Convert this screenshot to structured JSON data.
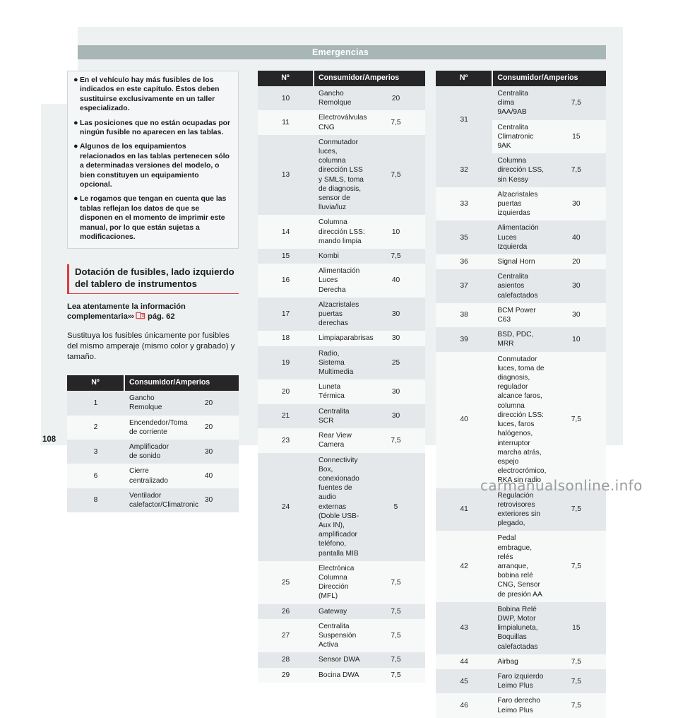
{
  "header": {
    "title": "Emergencias"
  },
  "folio": "108",
  "watermark": "carmanualsonline.info",
  "note_box": {
    "items": [
      "En el vehículo hay más fusibles de los indicados en este capítulo. Éstos deben sustituirse exclusivamente en un taller especializado.",
      "Las posiciones que no están ocupadas por ningún fusible no aparecen en las tablas.",
      "Algunos de los equipamientos relacionados en las tablas pertenecen sólo a determinadas versiones del modelo, o bien constituyen un equipamiento opcional.",
      "Le rogamos que tengan en cuenta que las tablas reflejan los datos de que se disponen en el momento de imprimir este manual, por lo que están sujetas a modificaciones."
    ],
    "bullet": "●"
  },
  "section": {
    "heading": "Dotación de fusibles, lado izquierdo del tablero de instrumentos",
    "lead_prefix": "Lea atentamente la información complementaria",
    "lead_chevrons": "›››",
    "lead_ref": "pág. 62",
    "ref_icon": "book-reference-icon",
    "body": "Sustituya los fusibles únicamente por fusibles del mismo amperaje (mismo color y grabado) y tamaño."
  },
  "tables": {
    "columns": {
      "num": "Nº",
      "consumer": "Consumidor/Amperios"
    },
    "left": [
      {
        "num": "1",
        "consumer": "Gancho Remolque",
        "amps": "20"
      },
      {
        "num": "2",
        "consumer": "Encendedor/Toma de corriente",
        "amps": "20"
      },
      {
        "num": "3",
        "consumer": "Amplificador de sonido",
        "amps": "30"
      },
      {
        "num": "6",
        "consumer": "Cierre centralizado",
        "amps": "40"
      },
      {
        "num": "8",
        "consumer": "Ventilador calefactor/Climatronic",
        "amps": "30"
      }
    ],
    "middle": [
      {
        "num": "10",
        "consumer": "Gancho Remolque",
        "amps": "20"
      },
      {
        "num": "11",
        "consumer": "Electroválvulas CNG",
        "amps": "7,5"
      },
      {
        "num": "13",
        "consumer": "Conmutador luces, columna dirección LSS y SMLS, toma de diagnosis, sensor de lluvia/luz",
        "amps": "7,5"
      },
      {
        "num": "14",
        "consumer": "Columna dirección LSS: mando limpia",
        "amps": "10"
      },
      {
        "num": "15",
        "consumer": "Kombi",
        "amps": "7,5"
      },
      {
        "num": "16",
        "consumer": "Alimentación Luces Derecha",
        "amps": "40"
      },
      {
        "num": "17",
        "consumer": "Alzacristales puertas derechas",
        "amps": "30"
      },
      {
        "num": "18",
        "consumer": "Limpiaparabrisas",
        "amps": "30"
      },
      {
        "num": "19",
        "consumer": "Radio, Sistema Multimedia",
        "amps": "25"
      },
      {
        "num": "20",
        "consumer": "Luneta Térmica",
        "amps": "30"
      },
      {
        "num": "21",
        "consumer": "Centralita SCR",
        "amps": "30"
      },
      {
        "num": "23",
        "consumer": "Rear View Camera",
        "amps": "7,5"
      },
      {
        "num": "24",
        "consumer": "Connectivity Box, conexionado fuentes de audio externas (Doble USB-Aux IN), amplificador teléfono, pantalla MIB",
        "amps": "5"
      },
      {
        "num": "25",
        "consumer": "Electrónica Columna Dirección (MFL)",
        "amps": "7,5"
      },
      {
        "num": "26",
        "consumer": "Gateway",
        "amps": "7,5"
      },
      {
        "num": "27",
        "consumer": "Centralita Suspensión Activa",
        "amps": "7,5"
      },
      {
        "num": "28",
        "consumer": "Sensor DWA",
        "amps": "7,5"
      },
      {
        "num": "29",
        "consumer": "Bocina DWA",
        "amps": "7,5"
      }
    ],
    "right": [
      {
        "num": "31",
        "consumer": "Centralita clima 9AA/9AB",
        "amps": "7,5",
        "rowspan_num": 2
      },
      {
        "num": "",
        "consumer": "Centralita Climatronic 9AK",
        "amps": "15",
        "num_merged": true
      },
      {
        "num": "32",
        "consumer": "Columna dirección LSS, sin Kessy",
        "amps": "7,5"
      },
      {
        "num": "33",
        "consumer": "Alzacristales puertas izquierdas",
        "amps": "30"
      },
      {
        "num": "35",
        "consumer": "Alimentación Luces Izquierda",
        "amps": "40"
      },
      {
        "num": "36",
        "consumer": "Signal Horn",
        "amps": "20"
      },
      {
        "num": "37",
        "consumer": "Centralita asientos calefactados",
        "amps": "30"
      },
      {
        "num": "38",
        "consumer": "BCM Power C63",
        "amps": "30"
      },
      {
        "num": "39",
        "consumer": "BSD, PDC, MRR",
        "amps": "10"
      },
      {
        "num": "40",
        "consumer": "Conmutador luces, toma de diagnosis, regulador alcance faros, columna dirección LSS: luces, faros halógenos, interruptor marcha atrás, espejo electrocrómico, RKA sin radio",
        "amps": "7,5"
      },
      {
        "num": "41",
        "consumer": "Regulación retrovisores exteriores sin plegado,",
        "amps": "7,5"
      },
      {
        "num": "42",
        "consumer": "Pedal embrague, relés arranque, bobina relé CNG, Sensor de presión AA",
        "amps": "7,5"
      },
      {
        "num": "43",
        "consumer": "Bobina Relé DWP, Motor limpialuneta, Boquillas calefactadas",
        "amps": "15"
      },
      {
        "num": "44",
        "consumer": "Airbag",
        "amps": "7,5"
      },
      {
        "num": "45",
        "consumer": "Faro izquierdo Leimo Plus",
        "amps": "7,5"
      },
      {
        "num": "46",
        "consumer": "Faro derecho Leimo Plus",
        "amps": "7,5"
      }
    ]
  },
  "colors": {
    "header_band": "#a8b6b6",
    "accent_red": "#e03a3e",
    "table_header": "#262626",
    "zebra": "#e4e8ea",
    "page_bg": "#eef1f2"
  }
}
